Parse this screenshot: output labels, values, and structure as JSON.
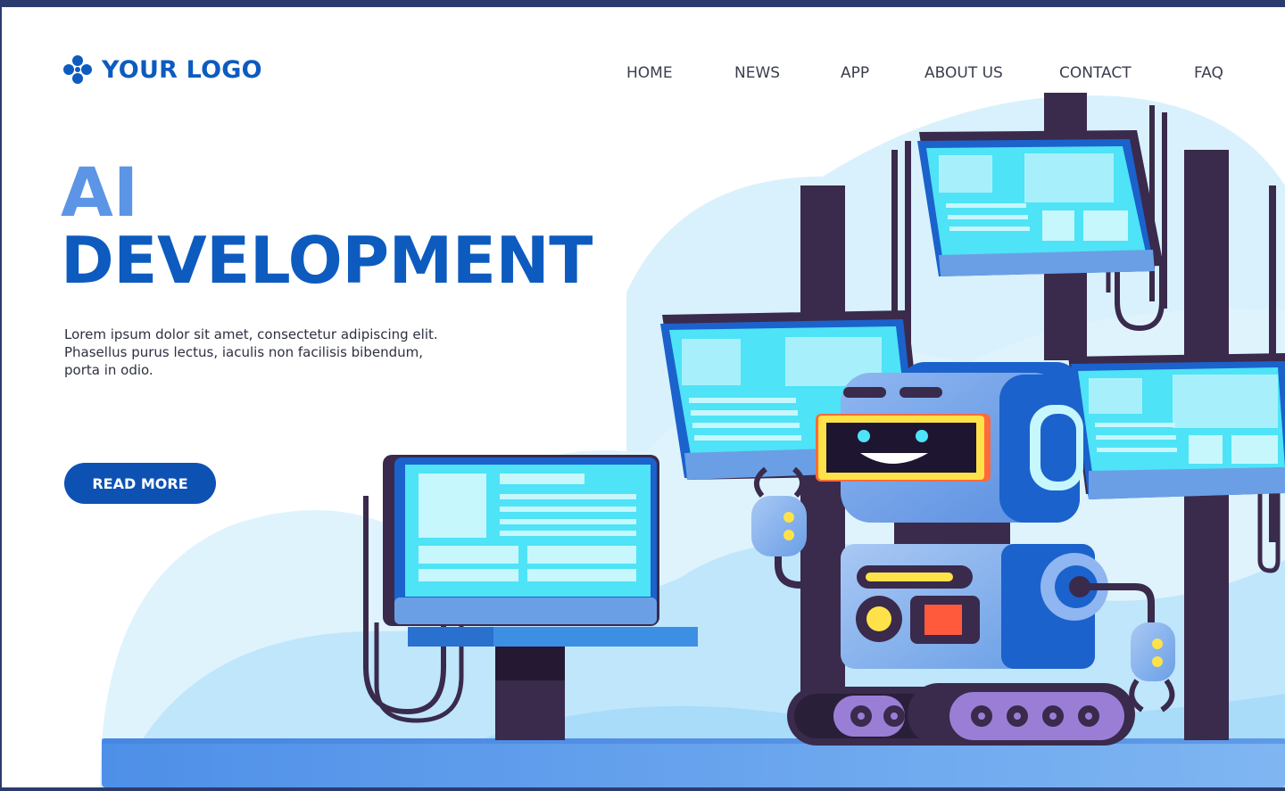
{
  "header": {
    "logo_text": "YOUR LOGO",
    "logo_icon": "four-dots-logo-icon",
    "nav": [
      {
        "label": "HOME"
      },
      {
        "label": "NEWS"
      },
      {
        "label": "APP"
      },
      {
        "label": "ABOUT US"
      },
      {
        "label": "CONTACT"
      },
      {
        "label": "FAQ"
      }
    ]
  },
  "hero": {
    "title_line1": "AI",
    "title_line2": "DEVELOPMENT",
    "description": [
      "Lorem ipsum dolor sit amet, consectetur adipiscing elit.",
      "Phasellus purus lectus, iaculis non facilisis bibendum,",
      "porta in odio."
    ],
    "cta_label": "READ MORE"
  },
  "theme": {
    "brand": "#0d5bbf",
    "accent_light": "#5c95e6",
    "button": "#0d52b3",
    "screen": "#4ee3f6",
    "pillar": "#3a2a4c",
    "frame": "#2c3b6e"
  }
}
